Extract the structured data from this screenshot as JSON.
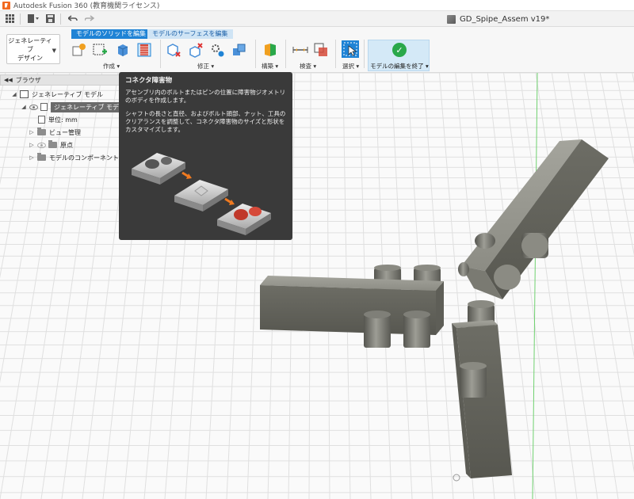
{
  "titlebar": {
    "app_title": "Autodesk Fusion 360 (教育機関ライセンス)"
  },
  "document": {
    "title": "GD_Spipe_Assem v19*"
  },
  "workspace": {
    "label_line1": "ジェネレーティブ",
    "label_line2": "デザイン"
  },
  "tabs": [
    {
      "label": "モデルのソリッドを編集",
      "active": true
    },
    {
      "label": "モデルのサーフェスを編集",
      "active": false
    }
  ],
  "toolbar_groups": {
    "create": "作成 ▾",
    "modify": "修正 ▾",
    "construct": "構築 ▾",
    "inspect": "検査 ▾",
    "select": "選択 ▾",
    "finish": "モデルの編集を終了 ▾"
  },
  "browser": {
    "header": "ブラウザ",
    "root": "ジェネレーティブ モデル",
    "active_model": "ジェネレーティブ モデル 1",
    "units": "単位: mm",
    "items": [
      "ビュー管理",
      "原点",
      "モデルのコンポーネント"
    ]
  },
  "tooltip": {
    "title": "コネクタ障害物",
    "desc1": "アセンブリ内のボルトまたはピンの位置に障害物ジオメトリのボディを作成します。",
    "desc2": "シャフトの長さと直径、およびボルト頭部、ナット、工具のクリアランスを調整して、コネクタ障害物のサイズと形状をカスタマイズします。"
  },
  "colors": {
    "accent": "#1f83d5",
    "finish_check": "#2aa84a",
    "tooltip_bg": "#3a3a3a",
    "part_gray": "#8e8e86",
    "obstacle_red": "#c0392b"
  }
}
